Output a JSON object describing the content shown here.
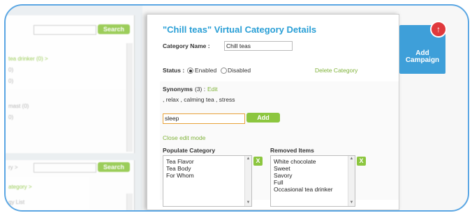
{
  "sidebar": {
    "search_label_1": "Search",
    "search_label_2": "Search",
    "item_1": "tea drinker (0) >",
    "item_2": "0)",
    "item_3": "0)",
    "item_4": "mast (0)",
    "item_5": "0)",
    "item_6": "ry >",
    "item_7": "ategory >",
    "item_8": "gy List"
  },
  "panel": {
    "title": "\"Chill teas\"  Virtual Category Details",
    "category_name_label": "Category Name :",
    "category_name_value": "Chill teas",
    "status_label": "Status :",
    "enabled_label": "Enabled",
    "disabled_label": "Disabled",
    "delete_link": "Delete Category",
    "synonyms_label": "Synonyms",
    "synonyms_count": "(3) :",
    "synonyms_edit": "Edit",
    "synonyms_list": ", relax  , calming tea  , stress",
    "synonym_input_value": "sleep",
    "add_label": "Add",
    "close_edit": "Close edit mode",
    "populate_label": "Populate Category",
    "removed_label": "Removed Items",
    "remove_x": "X",
    "restore_x": "X",
    "populate_items": [
      "Tea Flavor",
      "Tea Body",
      "For Whom"
    ],
    "removed_items": [
      "White chocolate",
      "Sweet",
      "Savory",
      "Full",
      "Occasional tea drinker"
    ]
  },
  "campaign": {
    "line1": "Add",
    "line2": "Campaign",
    "color": "#3e9fd9"
  }
}
